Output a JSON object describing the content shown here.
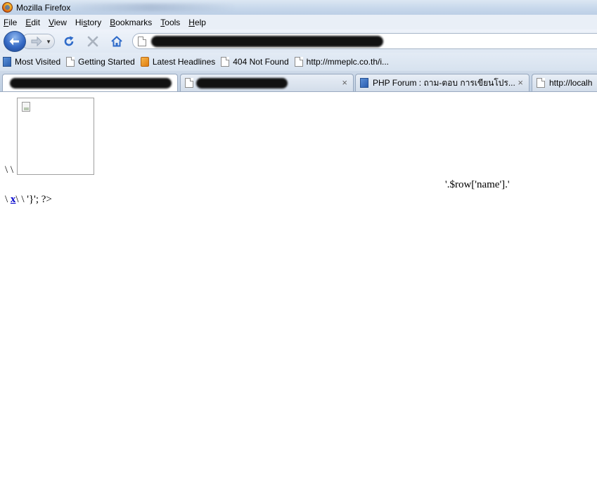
{
  "window": {
    "title": "Mozilla Firefox"
  },
  "menu": {
    "items": [
      {
        "key": "F",
        "rest": "ile"
      },
      {
        "key": "E",
        "rest": "dit"
      },
      {
        "key": "V",
        "rest": "iew"
      },
      {
        "pre": "Hi",
        "key": "s",
        "rest": "tory"
      },
      {
        "key": "B",
        "rest": "ookmarks"
      },
      {
        "key": "T",
        "rest": "ools"
      },
      {
        "key": "H",
        "rest": "elp"
      }
    ]
  },
  "bookmarks": {
    "items": [
      {
        "label": "Most Visited",
        "icon": "most-visited-icon"
      },
      {
        "label": "Getting Started",
        "icon": "page-icon"
      },
      {
        "label": "Latest Headlines",
        "icon": "rss-icon"
      },
      {
        "label": "404 Not Found",
        "icon": "page-icon"
      },
      {
        "label": "http://mmeplc.co.th/i...",
        "icon": "page-icon"
      }
    ]
  },
  "tabs": {
    "php_forum": "PHP Forum : ถาม-ตอบ การเขียนโปร...",
    "localhost": "http://localh",
    "close_glyph": "×"
  },
  "content": {
    "line_backslashes": "\\ \\",
    "row_name_text": "'.$row['name'].'",
    "line_end_prefix": "\\ ",
    "link_x": "x",
    "line_end_suffix": "\\ \\ '}'; ?>"
  }
}
